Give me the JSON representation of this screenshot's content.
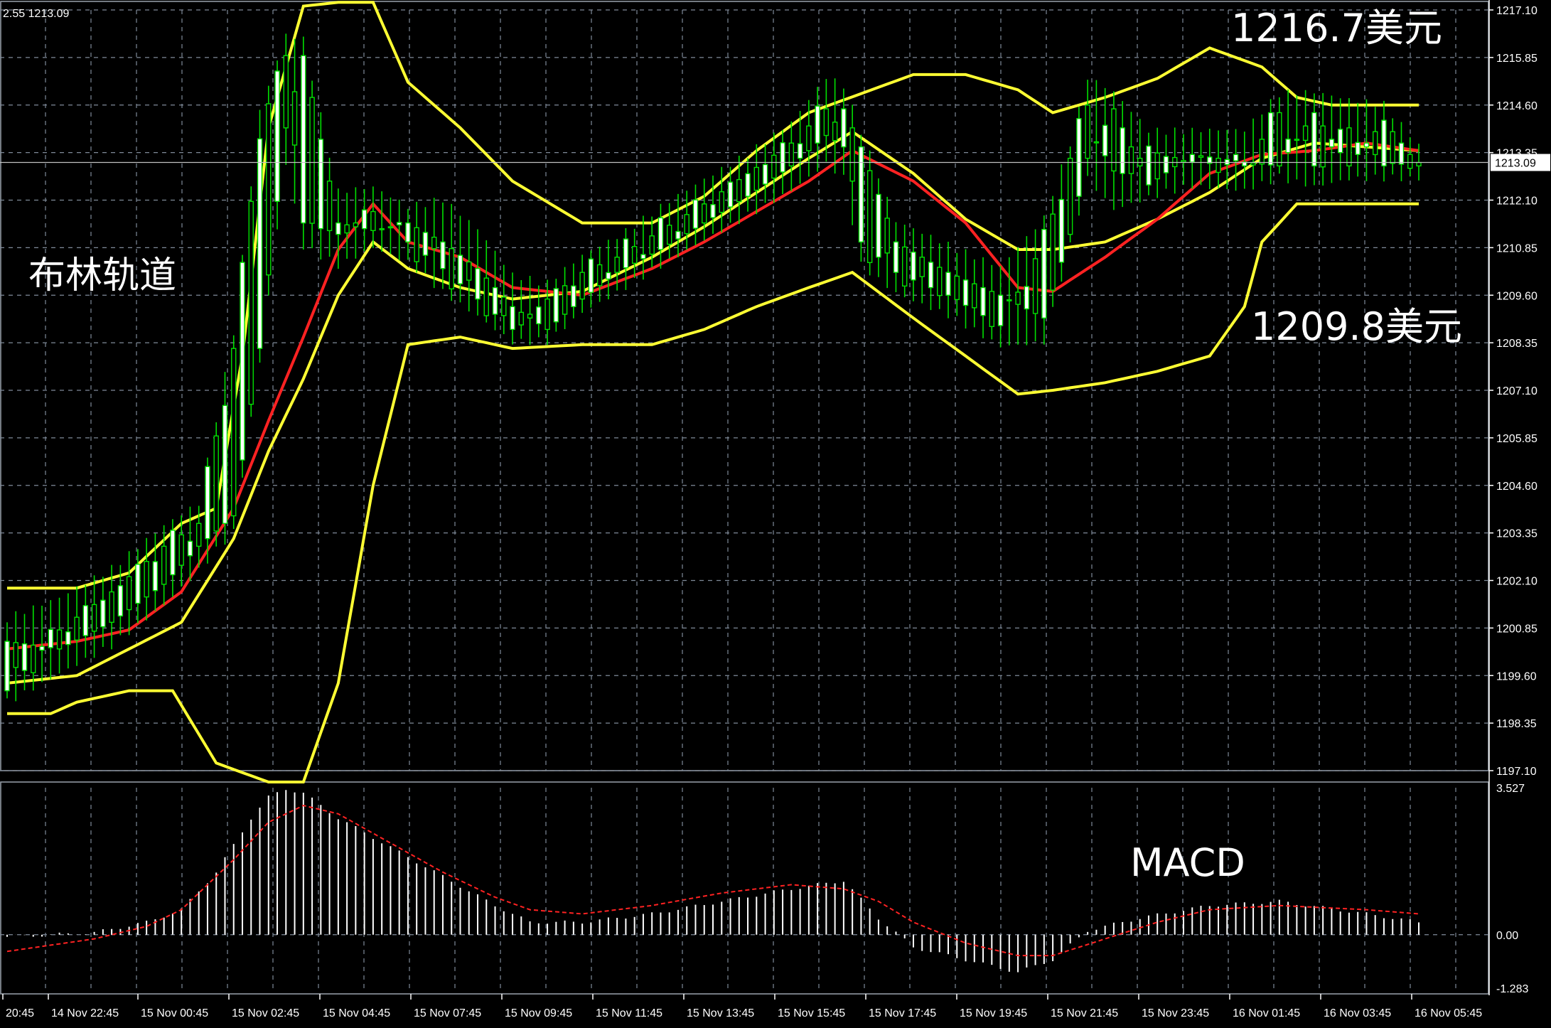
{
  "window": {
    "header_text": "2.55 1213.09",
    "current_price_label": "1213.09"
  },
  "annotations": {
    "bollinger_label": "布林轨道",
    "upper_target": "1216.7美元",
    "lower_target": "1209.8美元",
    "macd_label": "MACD"
  },
  "colors": {
    "background": "#000000",
    "grid": "#7f8a99",
    "bull_candle": "#00e000",
    "bear_candle_body": "#ffffff",
    "bollinger": "#ffff33",
    "middle_band": "#ff2222",
    "macd_hist": "#ffffff",
    "macd_signal": "#ff2222",
    "axis_text": "#ffffff"
  },
  "chart_data": [
    {
      "type": "candlestick",
      "title": "",
      "ylim": [
        1197.1,
        1217.1
      ],
      "y_ticks": [
        "1217.10",
        "1215.85",
        "1214.60",
        "1213.35",
        "1212.10",
        "1210.85",
        "1209.60",
        "1208.35",
        "1207.10",
        "1205.85",
        "1204.60",
        "1203.35",
        "1202.10",
        "1200.85",
        "1199.60",
        "1198.35",
        "1197.10"
      ],
      "x_tick_labels": [
        "20:45",
        "14 Nov 22:45",
        "15 Nov 00:45",
        "15 Nov 02:45",
        "15 Nov 04:45",
        "15 Nov 07:45",
        "15 Nov 09:45",
        "15 Nov 11:45",
        "15 Nov 13:45",
        "15 Nov 15:45",
        "15 Nov 17:45",
        "15 Nov 19:45",
        "15 Nov 21:45",
        "15 Nov 23:45",
        "16 Nov 01:45",
        "16 Nov 03:45",
        "16 Nov 05:45"
      ],
      "last_price": 1213.09,
      "ohlc_keyframes": [
        [
          0,
          1200.5,
          1201.0,
          1199.0,
          1199.2
        ],
        [
          6,
          1200.3,
          1201.5,
          1199.8,
          1200.8
        ],
        [
          12,
          1201.0,
          1202.3,
          1200.5,
          1201.8
        ],
        [
          18,
          1202.0,
          1203.4,
          1201.6,
          1203.0
        ],
        [
          22,
          1203.0,
          1204.0,
          1202.5,
          1203.6
        ],
        [
          26,
          1203.8,
          1208.5,
          1203.5,
          1208.2
        ],
        [
          29,
          1208.2,
          1214.3,
          1208.0,
          1214.0
        ],
        [
          32,
          1214.0,
          1216.3,
          1213.2,
          1215.9
        ],
        [
          34,
          1215.9,
          1216.2,
          1211.0,
          1211.5
        ],
        [
          38,
          1211.5,
          1212.2,
          1210.5,
          1211.2
        ],
        [
          42,
          1211.3,
          1212.3,
          1211.0,
          1211.8
        ],
        [
          46,
          1211.5,
          1211.8,
          1210.6,
          1211.0
        ],
        [
          50,
          1211.0,
          1212.0,
          1209.8,
          1210.3
        ],
        [
          54,
          1210.3,
          1211.2,
          1209.2,
          1209.5
        ],
        [
          58,
          1209.3,
          1210.0,
          1208.5,
          1208.7
        ],
        [
          62,
          1208.7,
          1209.8,
          1208.5,
          1209.5
        ],
        [
          66,
          1209.5,
          1210.5,
          1209.3,
          1210.2
        ],
        [
          70,
          1210.2,
          1211.0,
          1209.8,
          1210.6
        ],
        [
          75,
          1210.8,
          1211.8,
          1210.5,
          1211.3
        ],
        [
          80,
          1211.5,
          1212.5,
          1211.2,
          1212.0
        ],
        [
          85,
          1212.2,
          1213.2,
          1211.8,
          1212.8
        ],
        [
          90,
          1213.0,
          1214.0,
          1212.5,
          1213.6
        ],
        [
          94,
          1213.8,
          1215.2,
          1213.2,
          1214.5
        ],
        [
          96,
          1214.5,
          1215.0,
          1212.8,
          1213.5
        ],
        [
          98,
          1213.5,
          1213.8,
          1210.5,
          1211.0
        ],
        [
          102,
          1211.0,
          1211.4,
          1209.8,
          1210.2
        ],
        [
          108,
          1210.2,
          1210.8,
          1209.2,
          1209.6
        ],
        [
          114,
          1209.6,
          1210.2,
          1208.4,
          1208.8
        ],
        [
          119,
          1209.0,
          1211.5,
          1208.5,
          1211.0
        ],
        [
          122,
          1211.2,
          1213.5,
          1211.0,
          1213.2
        ],
        [
          124,
          1213.2,
          1215.2,
          1212.8,
          1214.6
        ],
        [
          127,
          1214.5,
          1214.8,
          1212.0,
          1212.6
        ],
        [
          131,
          1212.5,
          1213.8,
          1212.3,
          1213.4
        ],
        [
          136,
          1213.3,
          1213.8,
          1212.6,
          1213.1
        ],
        [
          142,
          1213.1,
          1213.8,
          1212.5,
          1213.0
        ],
        [
          146,
          1213.0,
          1214.8,
          1212.8,
          1214.4
        ],
        [
          150,
          1214.4,
          1214.8,
          1212.6,
          1213.0
        ],
        [
          154,
          1213.0,
          1214.6,
          1212.8,
          1214.0
        ],
        [
          158,
          1214.2,
          1214.5,
          1212.8,
          1213.0
        ],
        [
          162,
          1213.0,
          1213.4,
          1212.8,
          1213.09
        ]
      ],
      "middle_band_keyframes": [
        [
          0,
          1200.3
        ],
        [
          8,
          1200.5
        ],
        [
          14,
          1200.8
        ],
        [
          20,
          1201.8
        ],
        [
          26,
          1204.0
        ],
        [
          30,
          1206.3
        ],
        [
          34,
          1208.5
        ],
        [
          38,
          1210.8
        ],
        [
          42,
          1212.0
        ],
        [
          46,
          1211.0
        ],
        [
          52,
          1210.6
        ],
        [
          58,
          1209.8
        ],
        [
          66,
          1209.6
        ],
        [
          74,
          1210.3
        ],
        [
          80,
          1211.0
        ],
        [
          86,
          1211.8
        ],
        [
          92,
          1212.6
        ],
        [
          97,
          1213.4
        ],
        [
          104,
          1212.6
        ],
        [
          110,
          1211.5
        ],
        [
          116,
          1209.8
        ],
        [
          120,
          1209.7
        ],
        [
          126,
          1210.6
        ],
        [
          132,
          1211.6
        ],
        [
          138,
          1212.8
        ],
        [
          144,
          1213.3
        ],
        [
          150,
          1213.4
        ],
        [
          156,
          1213.6
        ],
        [
          162,
          1213.4
        ]
      ],
      "upper_band_keyframes": [
        [
          0,
          1201.9
        ],
        [
          8,
          1201.9
        ],
        [
          14,
          1202.3
        ],
        [
          20,
          1203.6
        ],
        [
          24,
          1204.0
        ],
        [
          27,
          1208.0
        ],
        [
          30,
          1214.0
        ],
        [
          34,
          1217.2
        ],
        [
          38,
          1217.3
        ],
        [
          42,
          1217.3
        ],
        [
          46,
          1215.2
        ],
        [
          52,
          1214.0
        ],
        [
          58,
          1212.6
        ],
        [
          66,
          1211.5
        ],
        [
          74,
          1211.5
        ],
        [
          80,
          1212.2
        ],
        [
          86,
          1213.4
        ],
        [
          92,
          1214.4
        ],
        [
          98,
          1214.9
        ],
        [
          104,
          1215.4
        ],
        [
          110,
          1215.4
        ],
        [
          116,
          1215.0
        ],
        [
          120,
          1214.4
        ],
        [
          126,
          1214.8
        ],
        [
          132,
          1215.3
        ],
        [
          138,
          1216.1
        ],
        [
          144,
          1215.6
        ],
        [
          148,
          1214.8
        ],
        [
          152,
          1214.6
        ],
        [
          162,
          1214.6
        ]
      ],
      "lower_band_keyframes": [
        [
          0,
          1198.6
        ],
        [
          5,
          1198.6
        ],
        [
          8,
          1198.9
        ],
        [
          14,
          1199.2
        ],
        [
          19,
          1199.2
        ],
        [
          24,
          1197.3
        ],
        [
          30,
          1196.8
        ],
        [
          34,
          1196.8
        ],
        [
          38,
          1199.4
        ],
        [
          42,
          1204.6
        ],
        [
          46,
          1208.3
        ],
        [
          52,
          1208.5
        ],
        [
          58,
          1208.2
        ],
        [
          66,
          1208.3
        ],
        [
          74,
          1208.3
        ],
        [
          80,
          1208.7
        ],
        [
          86,
          1209.3
        ],
        [
          92,
          1209.8
        ],
        [
          97,
          1210.2
        ],
        [
          104,
          1209.0
        ],
        [
          110,
          1208.0
        ],
        [
          116,
          1207.0
        ],
        [
          120,
          1207.1
        ],
        [
          126,
          1207.3
        ],
        [
          132,
          1207.6
        ],
        [
          138,
          1208.0
        ],
        [
          142,
          1209.3
        ],
        [
          144,
          1211.0
        ],
        [
          148,
          1212.0
        ],
        [
          162,
          1212.0
        ]
      ],
      "inner_band_keyframes": [
        [
          0,
          1199.4
        ],
        [
          8,
          1199.6
        ],
        [
          14,
          1200.3
        ],
        [
          20,
          1201.0
        ],
        [
          26,
          1203.2
        ],
        [
          30,
          1205.5
        ],
        [
          34,
          1207.4
        ],
        [
          38,
          1209.6
        ],
        [
          42,
          1211.0
        ],
        [
          46,
          1210.3
        ],
        [
          52,
          1209.8
        ],
        [
          58,
          1209.5
        ],
        [
          66,
          1209.7
        ],
        [
          74,
          1210.6
        ],
        [
          80,
          1211.4
        ],
        [
          86,
          1212.3
        ],
        [
          92,
          1213.2
        ],
        [
          97,
          1213.9
        ],
        [
          104,
          1212.8
        ],
        [
          110,
          1211.6
        ],
        [
          116,
          1210.8
        ],
        [
          120,
          1210.8
        ],
        [
          126,
          1211.0
        ],
        [
          132,
          1211.6
        ],
        [
          138,
          1212.3
        ],
        [
          144,
          1213.2
        ],
        [
          150,
          1213.6
        ],
        [
          156,
          1213.5
        ],
        [
          162,
          1213.4
        ]
      ]
    },
    {
      "type": "macd",
      "title": "",
      "ylim": [
        -1.283,
        3.527
      ],
      "y_ticks": [
        "3.527",
        "0.00",
        "-1.283"
      ],
      "histogram_keyframes": [
        [
          0,
          -0.05
        ],
        [
          10,
          0.05
        ],
        [
          16,
          0.3
        ],
        [
          20,
          0.6
        ],
        [
          24,
          1.5
        ],
        [
          28,
          2.8
        ],
        [
          30,
          3.3
        ],
        [
          32,
          3.5
        ],
        [
          34,
          3.4
        ],
        [
          38,
          2.8
        ],
        [
          44,
          2.1
        ],
        [
          50,
          1.4
        ],
        [
          56,
          0.7
        ],
        [
          60,
          0.3
        ],
        [
          66,
          0.3
        ],
        [
          74,
          0.5
        ],
        [
          82,
          0.8
        ],
        [
          90,
          1.1
        ],
        [
          96,
          1.3
        ],
        [
          100,
          0.4
        ],
        [
          104,
          -0.3
        ],
        [
          110,
          -0.6
        ],
        [
          116,
          -0.9
        ],
        [
          120,
          -0.6
        ],
        [
          124,
          0.1
        ],
        [
          130,
          0.4
        ],
        [
          138,
          0.7
        ],
        [
          146,
          0.8
        ],
        [
          156,
          0.5
        ],
        [
          162,
          0.3
        ]
      ],
      "signal_keyframes": [
        [
          0,
          -0.4
        ],
        [
          10,
          -0.1
        ],
        [
          16,
          0.2
        ],
        [
          20,
          0.6
        ],
        [
          26,
          1.8
        ],
        [
          30,
          2.7
        ],
        [
          34,
          3.1
        ],
        [
          38,
          2.9
        ],
        [
          44,
          2.2
        ],
        [
          50,
          1.5
        ],
        [
          56,
          0.9
        ],
        [
          60,
          0.6
        ],
        [
          66,
          0.5
        ],
        [
          74,
          0.7
        ],
        [
          82,
          1.0
        ],
        [
          90,
          1.2
        ],
        [
          96,
          1.1
        ],
        [
          100,
          0.8
        ],
        [
          104,
          0.3
        ],
        [
          110,
          -0.2
        ],
        [
          116,
          -0.5
        ],
        [
          120,
          -0.5
        ],
        [
          126,
          -0.1
        ],
        [
          132,
          0.3
        ],
        [
          138,
          0.6
        ],
        [
          146,
          0.7
        ],
        [
          156,
          0.6
        ],
        [
          162,
          0.5
        ]
      ]
    }
  ]
}
